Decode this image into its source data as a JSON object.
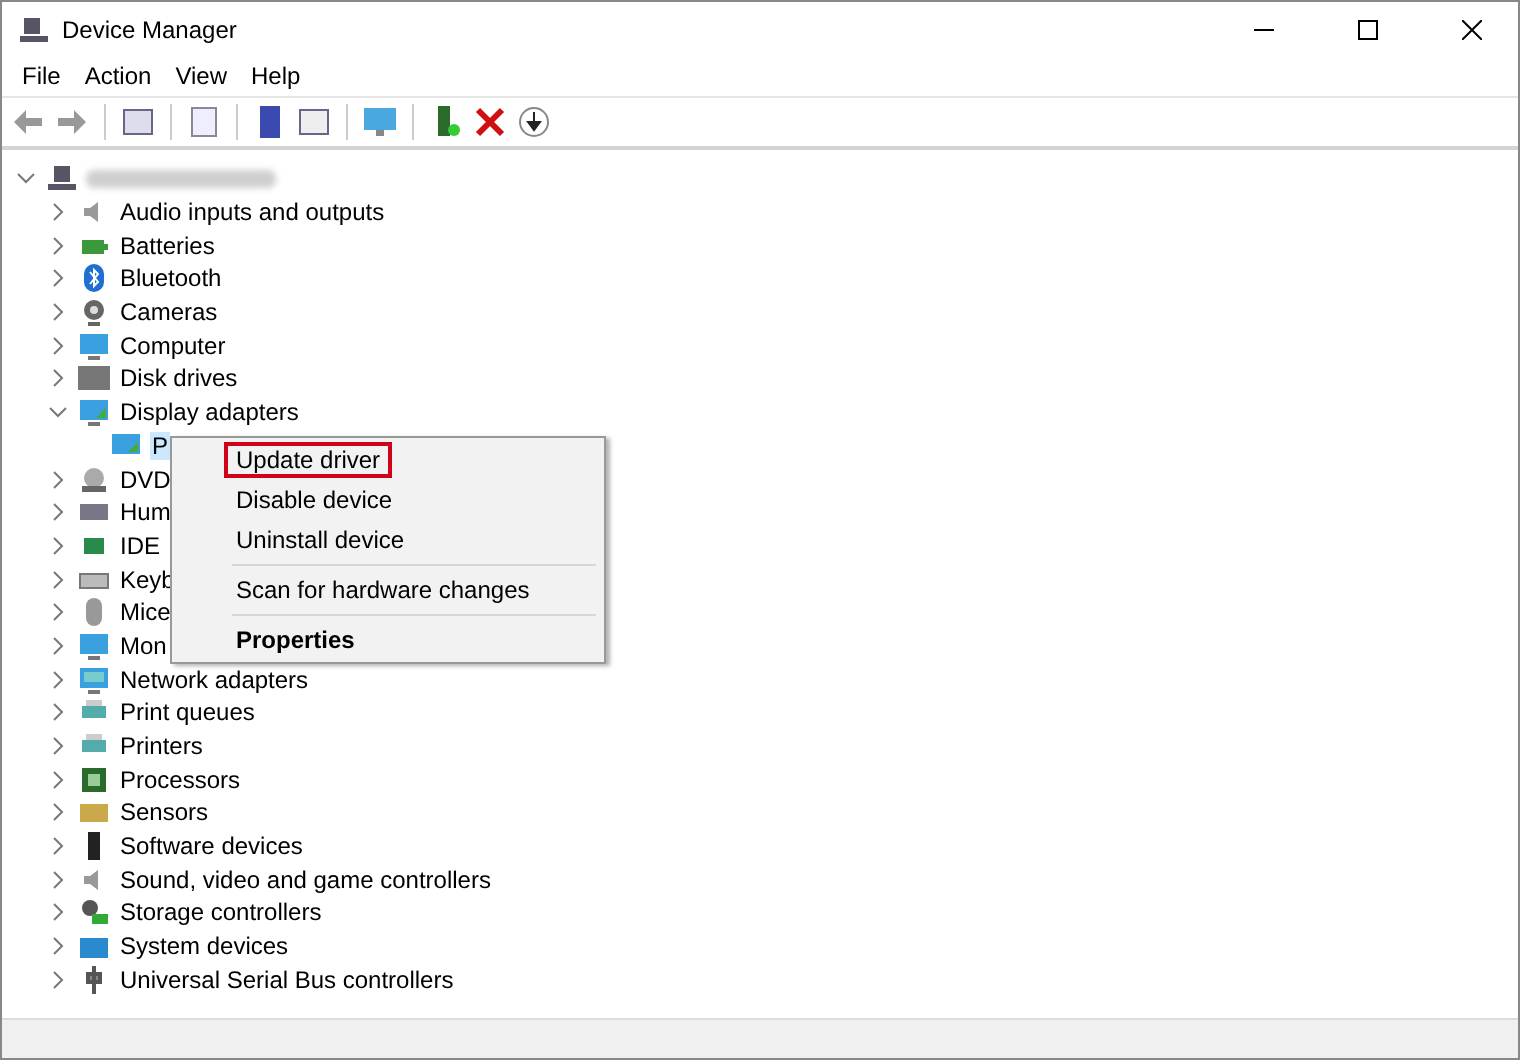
{
  "window": {
    "title": "Device Manager"
  },
  "menu_bar": [
    "File",
    "Action",
    "View",
    "Help"
  ],
  "tree": {
    "expanded": true,
    "children": [
      {
        "label": "Audio inputs and outputs",
        "expanded": false
      },
      {
        "label": "Batteries",
        "expanded": false
      },
      {
        "label": "Bluetooth",
        "expanded": false
      },
      {
        "label": "Cameras",
        "expanded": false
      },
      {
        "label": "Computer",
        "expanded": false
      },
      {
        "label": "Disk drives",
        "expanded": false
      },
      {
        "label": "Display adapters",
        "expanded": true,
        "children": [
          {
            "label": "P",
            "selected": true
          }
        ]
      },
      {
        "label": "DVD",
        "expanded": false
      },
      {
        "label": "Hum",
        "expanded": false
      },
      {
        "label": "IDE",
        "expanded": false
      },
      {
        "label": "Keyb",
        "expanded": false
      },
      {
        "label": "Mice",
        "expanded": false
      },
      {
        "label": "Mon",
        "expanded": false
      },
      {
        "label": "Network adapters",
        "expanded": false
      },
      {
        "label": "Print queues",
        "expanded": false
      },
      {
        "label": "Printers",
        "expanded": false
      },
      {
        "label": "Processors",
        "expanded": false
      },
      {
        "label": "Sensors",
        "expanded": false
      },
      {
        "label": "Software devices",
        "expanded": false
      },
      {
        "label": "Sound, video and game controllers",
        "expanded": false
      },
      {
        "label": "Storage controllers",
        "expanded": false
      },
      {
        "label": "System devices",
        "expanded": false
      },
      {
        "label": "Universal Serial Bus controllers",
        "expanded": false
      }
    ]
  },
  "context_menu": {
    "items": [
      {
        "kind": "item",
        "label": "Update driver",
        "highlighted": true,
        "bold": false
      },
      {
        "kind": "item",
        "label": "Disable device",
        "highlighted": false,
        "bold": false
      },
      {
        "kind": "item",
        "label": "Uninstall device",
        "highlighted": false,
        "bold": false
      },
      {
        "kind": "separator"
      },
      {
        "kind": "item",
        "label": "Scan for hardware changes",
        "highlighted": false,
        "bold": false
      },
      {
        "kind": "separator"
      },
      {
        "kind": "item",
        "label": "Properties",
        "highlighted": false,
        "bold": true
      }
    ]
  }
}
